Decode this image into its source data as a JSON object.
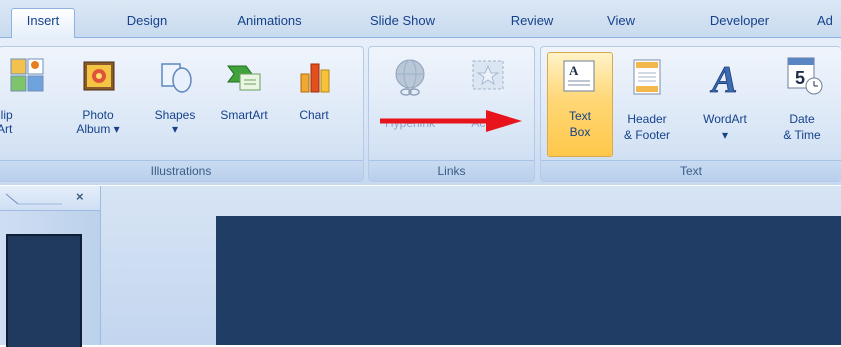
{
  "tabs": [
    {
      "label": "Insert",
      "active": true
    },
    {
      "label": "Design"
    },
    {
      "label": "Animations"
    },
    {
      "label": "Slide Show"
    },
    {
      "label": "Review"
    },
    {
      "label": "View"
    },
    {
      "label": "Developer"
    },
    {
      "label": "Ad"
    }
  ],
  "groups": {
    "illustrations": {
      "label": "Illustrations",
      "buttons": {
        "clip_art": [
          "Clip",
          "Art"
        ],
        "photo_album": [
          "Photo",
          "Album ▾"
        ],
        "shapes": [
          "Shapes",
          "▾"
        ],
        "smartart": [
          "SmartArt"
        ],
        "chart": [
          "Chart"
        ]
      }
    },
    "links": {
      "label": "Links",
      "buttons": {
        "hyperlink": [
          "Hyperlink"
        ],
        "action": [
          "Action"
        ]
      }
    },
    "text": {
      "label": "Text",
      "buttons": {
        "text_box": [
          "Text",
          "Box"
        ],
        "header_footer": [
          "Header",
          "& Footer"
        ],
        "wordart": [
          "WordArt",
          "▾"
        ],
        "date_time": [
          "Date",
          "& Time"
        ]
      }
    }
  },
  "colors": {
    "arrow": "#e8141b",
    "selected_button": "#ffd776",
    "slide_background": "#1f3d65"
  }
}
